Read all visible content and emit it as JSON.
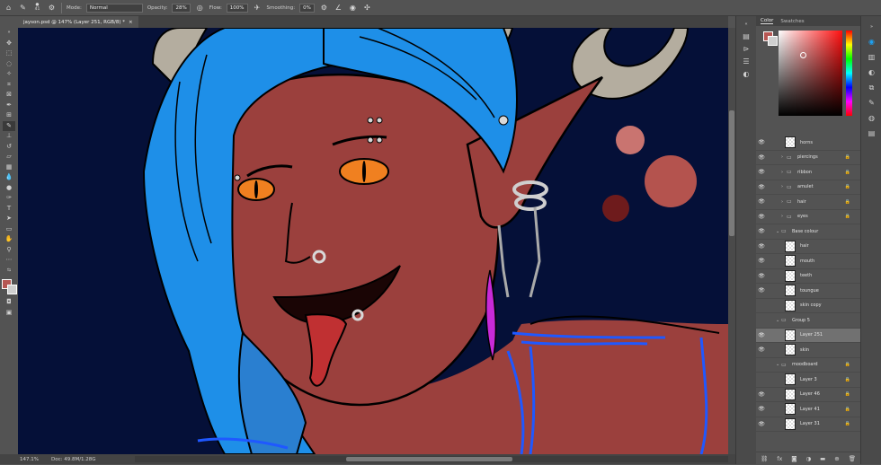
{
  "options_bar": {
    "brush_size": "41",
    "mode_label": "Mode:",
    "mode_value": "Normal",
    "opacity_label": "Opacity:",
    "opacity_value": "28%",
    "flow_label": "Flow:",
    "flow_value": "100%",
    "smoothing_label": "Smoothing:",
    "smoothing_value": "0%"
  },
  "document_tab": {
    "title": "jayson.psd @ 147% (Layer 251, RGB/8) *",
    "close": "×"
  },
  "status_bar": {
    "zoom": "147.1%",
    "doc": "Doc: 49.8M/1.28G"
  },
  "panel": {
    "tabs": [
      {
        "label": "Color"
      },
      {
        "label": "Swatches"
      }
    ],
    "foreground_color": "#b65754",
    "background_color": "#cfcfcf"
  },
  "layers": [
    {
      "name": "horns",
      "kind": "layer",
      "visible": true
    },
    {
      "name": "piercings",
      "kind": "group",
      "visible": true,
      "locked": true
    },
    {
      "name": "ribbon",
      "kind": "group",
      "visible": true,
      "locked": true
    },
    {
      "name": "amulet",
      "kind": "group",
      "visible": true,
      "locked": true
    },
    {
      "name": "hair",
      "kind": "group",
      "visible": true,
      "locked": true
    },
    {
      "name": "eyes",
      "kind": "group",
      "visible": true,
      "locked": true
    },
    {
      "name": "Base colour",
      "kind": "group-open",
      "visible": true
    },
    {
      "name": "hair",
      "kind": "layer",
      "visible": true
    },
    {
      "name": "mouth",
      "kind": "layer",
      "visible": true
    },
    {
      "name": "teeth",
      "kind": "layer",
      "visible": true
    },
    {
      "name": "toungue",
      "kind": "layer",
      "visible": true
    },
    {
      "name": "skin copy",
      "kind": "layer",
      "visible": false
    },
    {
      "name": "Group 5",
      "kind": "group-open",
      "visible": false
    },
    {
      "name": "Layer 251",
      "kind": "layer",
      "visible": true,
      "selected": true
    },
    {
      "name": "skin",
      "kind": "layer",
      "visible": true
    },
    {
      "name": "moodboard",
      "kind": "group-open",
      "visible": false,
      "locked": true
    },
    {
      "name": "Layer 3",
      "kind": "layer",
      "visible": false,
      "locked": true
    },
    {
      "name": "Layer 46",
      "kind": "layer",
      "visible": true,
      "locked": true
    },
    {
      "name": "Layer 41",
      "kind": "layer",
      "visible": true,
      "locked": true
    },
    {
      "name": "Layer 31",
      "kind": "layer",
      "visible": true,
      "locked": true
    }
  ],
  "artwork": {
    "skin_color": "#9b403d",
    "hair_color": "#1e8fe8",
    "background_color": "#051038",
    "eye_color": "#f08020",
    "horn_color": "#b4ad9f",
    "feather_color": "#c82ad8"
  }
}
